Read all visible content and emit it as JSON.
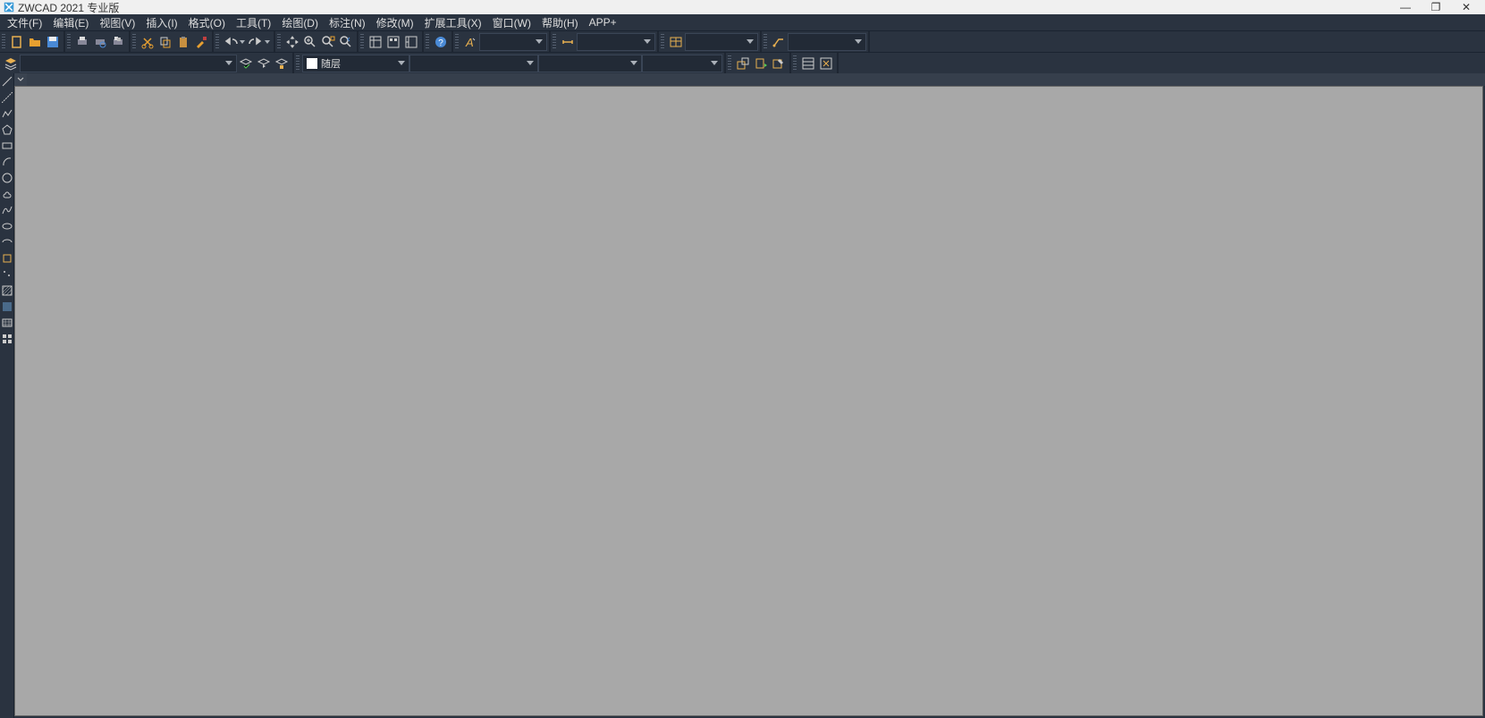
{
  "title": "ZWCAD 2021 专业版",
  "window": {
    "minimize": "—",
    "maximize": "❐",
    "close": "✕"
  },
  "menu": [
    {
      "label": "文件(F)"
    },
    {
      "label": "编辑(E)"
    },
    {
      "label": "视图(V)"
    },
    {
      "label": "插入(I)"
    },
    {
      "label": "格式(O)"
    },
    {
      "label": "工具(T)"
    },
    {
      "label": "绘图(D)"
    },
    {
      "label": "标注(N)"
    },
    {
      "label": "修改(M)"
    },
    {
      "label": "扩展工具(X)"
    },
    {
      "label": "窗口(W)"
    },
    {
      "label": "帮助(H)"
    },
    {
      "label": "APP+"
    }
  ],
  "row1": {
    "file": {
      "new": "new-file",
      "open": "open-folder",
      "save": "save"
    },
    "print": {
      "plot": "plot",
      "preview": "preview",
      "publish": "publish"
    },
    "edit": {
      "cut": "cut",
      "copy": "copy",
      "paste": "paste",
      "match": "match-prop"
    },
    "undo": {
      "undo": "undo",
      "redo": "redo"
    },
    "nav": {
      "pan": "pan",
      "zoomrt": "zoom-realtime",
      "zoomwin": "zoom-window",
      "zoomprev": "zoom-prev"
    },
    "wnd": {
      "w1": "window1",
      "w2": "window2",
      "w3": "window3"
    },
    "help": {
      "help": "help"
    },
    "text": {
      "txt": "text-style",
      "combo_text": ""
    },
    "dim": {
      "dim": "dim-style",
      "combo_dim": ""
    },
    "tbl": {
      "tbl": "table-style",
      "combo_tbl": ""
    },
    "mls": {
      "ml": "multileader",
      "combo_ml": ""
    }
  },
  "row2": {
    "layer": {
      "mgr": "layer-mgr",
      "combo_layer": ""
    },
    "layerops": {
      "a": "set-current",
      "b": "layer-prev",
      "c": "layer-lock"
    },
    "color": {
      "combo_color": "随层"
    },
    "ltype": {
      "combo_ltype": ""
    },
    "lweight": {
      "combo_lw": ""
    },
    "plotstyle": {
      "combo_ps": ""
    },
    "block": {
      "make": "block-make",
      "insert": "block-insert",
      "edit": "block-edit"
    },
    "ref": {
      "list": "xref-list",
      "clip": "xref-clip"
    }
  },
  "vtools": [
    "line",
    "construction-line",
    "polyline",
    "polygon",
    "rectangle",
    "arc",
    "circle",
    "revcloud",
    "spline",
    "ellipse",
    "ellipse-arc",
    "block-insert",
    "point",
    "hatch",
    "region",
    "table",
    "mtext"
  ]
}
